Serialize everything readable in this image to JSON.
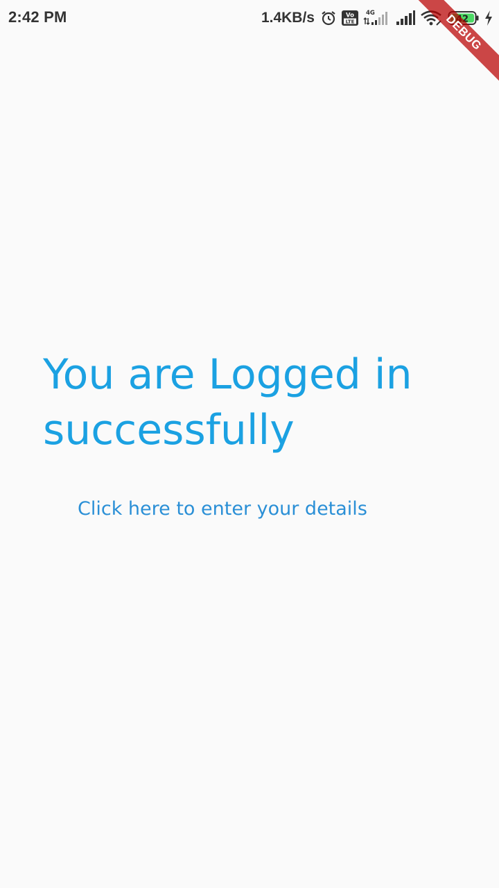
{
  "status_bar": {
    "time": "2:42 PM",
    "net_speed": "1.4KB/s",
    "network_type": "4G",
    "volte_label_top": "Vo",
    "volte_label_bottom": "LTE",
    "battery_level": "42",
    "icons": [
      "alarm-icon",
      "volte-icon",
      "signal-4g-icon",
      "signal-icon",
      "wifi-icon",
      "battery-icon",
      "charging-icon"
    ]
  },
  "debug_banner": {
    "label": "DEBUG"
  },
  "main": {
    "title": "You are Logged in successfully",
    "details_link": "Click here to enter your details"
  },
  "colors": {
    "background": "#fafafa",
    "accent": "#1ba1e2",
    "link": "#2a8fd6",
    "debug_ribbon": "#b80000"
  }
}
